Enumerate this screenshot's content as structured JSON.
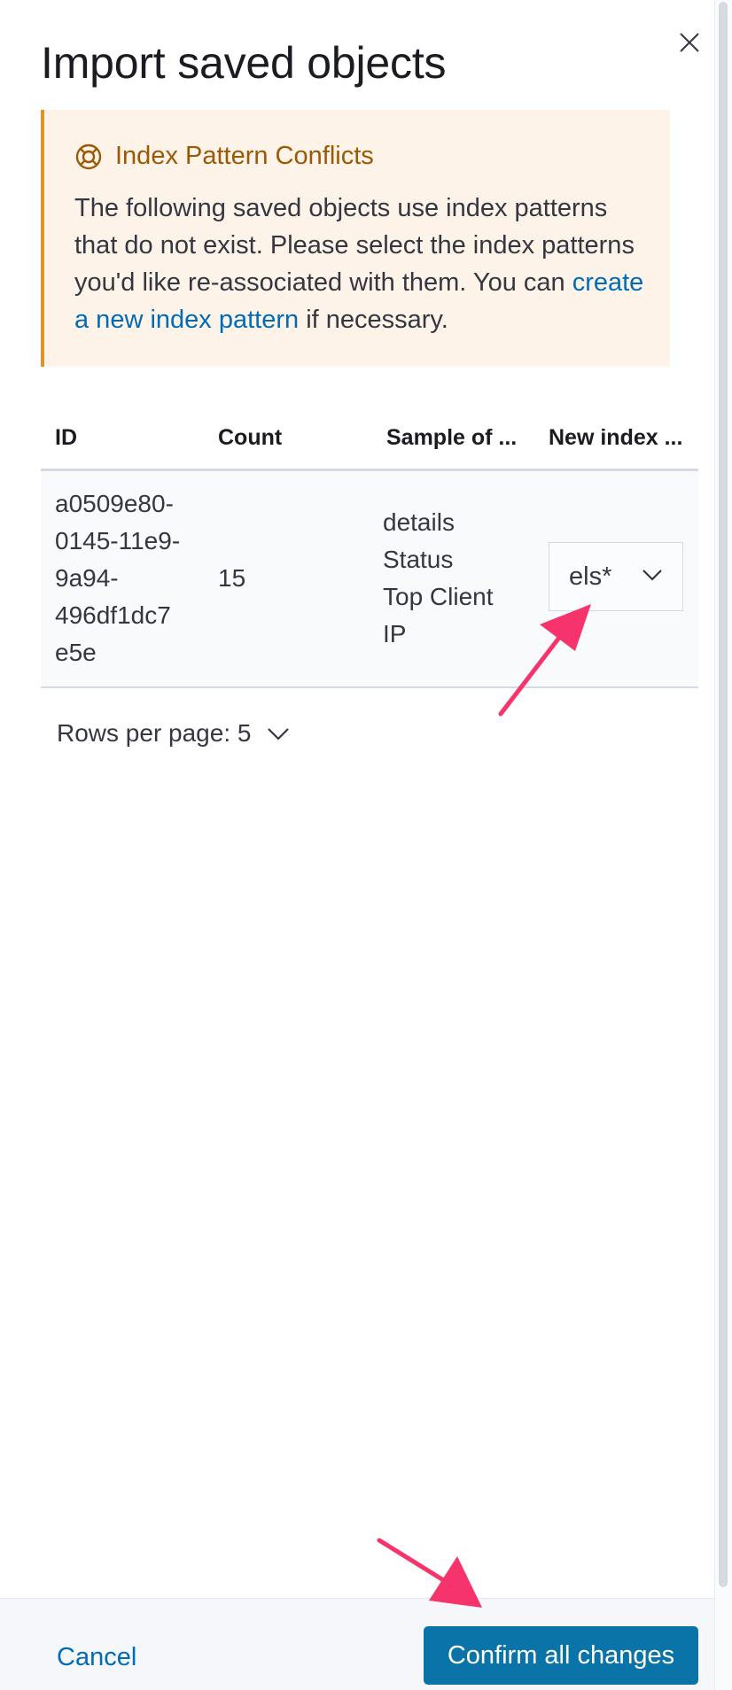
{
  "flyout": {
    "title": "Import saved objects",
    "close_icon": "close-icon"
  },
  "callout": {
    "icon": "life-ring-icon",
    "title": "Index Pattern Conflicts",
    "body_before": "The following saved objects use index patterns that do not exist. Please select the index patterns you'd like re-associated with them. You can",
    "link_text": "create a new index pattern",
    "body_after": "if necessary.",
    "colors": {
      "background": "#fdf3e8",
      "border": "#e0932d",
      "title": "#9a5a05"
    }
  },
  "table": {
    "columns": [
      "ID",
      "Count",
      "Sample of ...",
      "New index ..."
    ],
    "rows": [
      {
        "id_lines": [
          "a0509e80-",
          "0145-11e9-",
          "9a94-",
          "496df1dc7",
          "e5e"
        ],
        "count": "15",
        "sample_lines": [
          "details",
          "Status",
          "Top Client",
          "IP"
        ],
        "new_index": "els*"
      }
    ]
  },
  "pagination": {
    "rows_per_page": "Rows per page: 5"
  },
  "footer": {
    "cancel_label": "Cancel",
    "confirm_label": "Confirm all changes",
    "confirm_color": "#0a73a8",
    "link_color": "#006bb8"
  },
  "annotations": {
    "arrow_color": "#f7336c"
  }
}
